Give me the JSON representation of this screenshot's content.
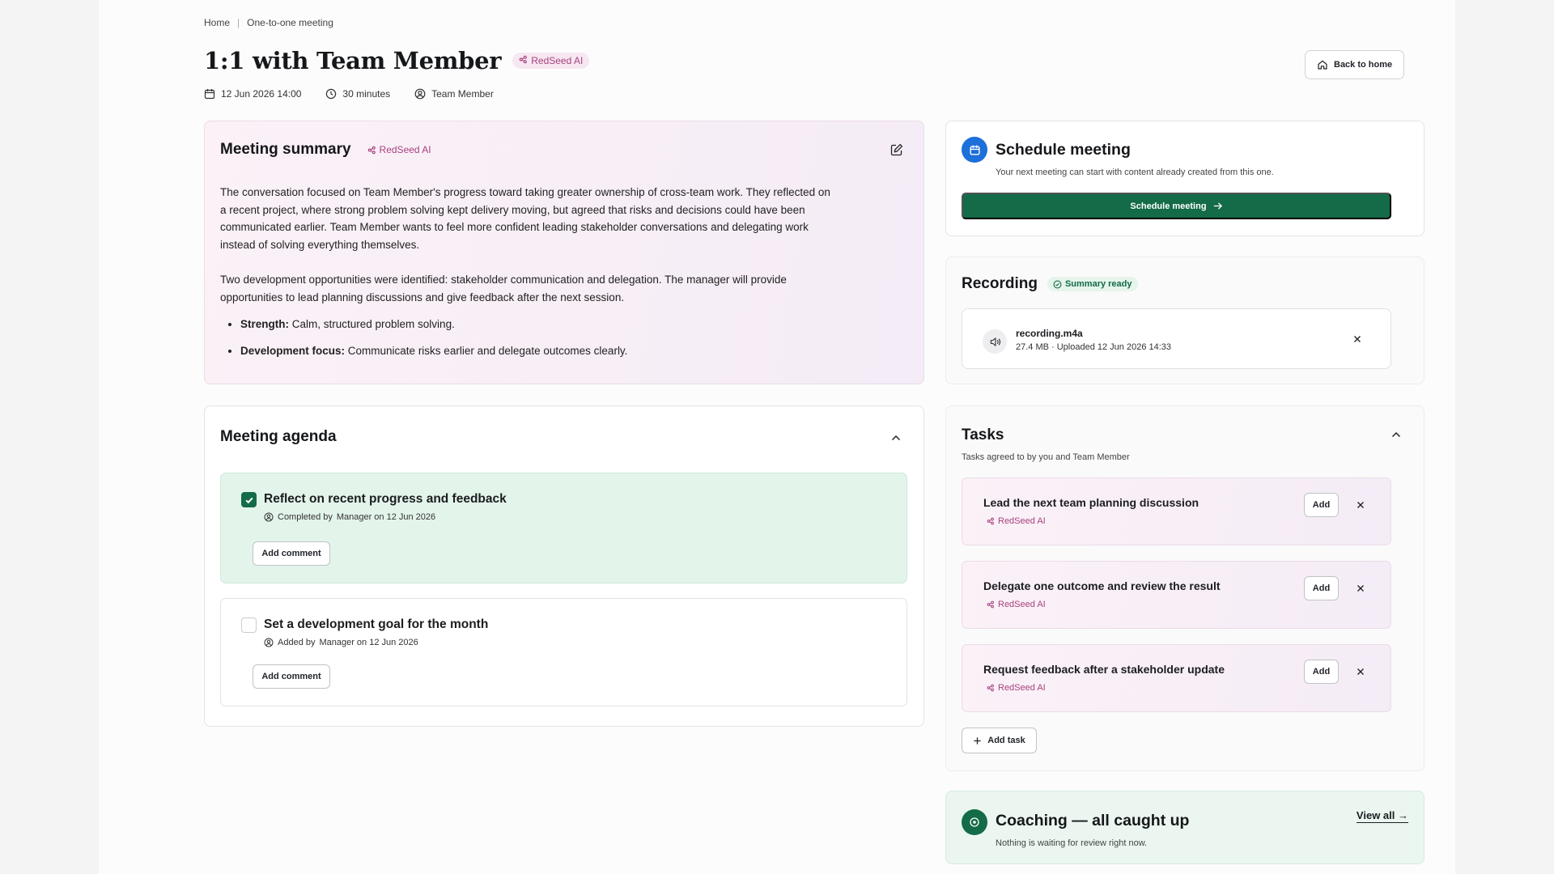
{
  "breadcrumb": {
    "home": "Home",
    "separator": "|",
    "current": "One-to-one meeting"
  },
  "header": {
    "title": "1:1 with Team Member",
    "ai_badge": "RedSeed AI",
    "date": "12 Jun 2026 14:00",
    "duration": "30 minutes",
    "participant": "Team Member",
    "back_label": "Back to home"
  },
  "summary": {
    "title": "Meeting summary",
    "ai_badge": "RedSeed AI",
    "paragraph_1": "The conversation focused on Team Member's progress toward taking greater ownership of cross-team work. They reflected on a recent project, where strong problem solving kept delivery moving, but agreed that risks and decisions could have been communicated earlier. Team Member wants to feel more confident leading stakeholder conversations and delegating work instead of solving everything themselves.",
    "paragraph_2": "Two development opportunities were identified: stakeholder communication and delegation. The manager will provide opportunities to lead planning discussions and give feedback after the next session.",
    "bullets": [
      {
        "label": "Strength:",
        "text": " Calm, structured problem solving."
      },
      {
        "label": "Development focus:",
        "text": " Communicate risks earlier and delegate outcomes clearly."
      }
    ]
  },
  "agenda": {
    "title": "Meeting agenda",
    "items": [
      {
        "title": "Reflect on recent progress and feedback",
        "status_prefix": "Completed by",
        "person": "Manager",
        "date_text": "on 12 Jun 2026",
        "comment_label": "Add comment",
        "checked": true
      },
      {
        "title": "Set a development goal for the month",
        "status_prefix": "Added by",
        "person": "Manager",
        "date_text": "on 12 Jun 2026",
        "comment_label": "Add comment",
        "checked": false
      }
    ]
  },
  "schedule": {
    "title": "Schedule meeting",
    "subtitle": "Your next meeting can start with content already created from this one.",
    "button_label": "Schedule meeting"
  },
  "recording": {
    "title": "Recording",
    "status": "Summary ready",
    "file_name": "recording.m4a",
    "file_meta": "27.4 MB · Uploaded 12 Jun 2026 14:33"
  },
  "tasks": {
    "title": "Tasks",
    "subtitle": "Tasks agreed to by you and Team Member",
    "items": [
      {
        "title": "Lead the next team planning discussion",
        "source": "RedSeed AI",
        "add_label": "Add"
      },
      {
        "title": "Delegate one outcome and review the result",
        "source": "RedSeed AI",
        "add_label": "Add"
      },
      {
        "title": "Request feedback after a stakeholder update",
        "source": "RedSeed AI",
        "add_label": "Add"
      }
    ],
    "add_task_label": "Add task"
  },
  "coaching": {
    "title": "Coaching — all caught up",
    "subtitle": "Nothing is waiting for review right now.",
    "view_all_label": "View all →"
  },
  "colors": {
    "primary": "#136b47",
    "ai_accent": "#a8417f",
    "schedule_icon": "#1d6fd9"
  }
}
